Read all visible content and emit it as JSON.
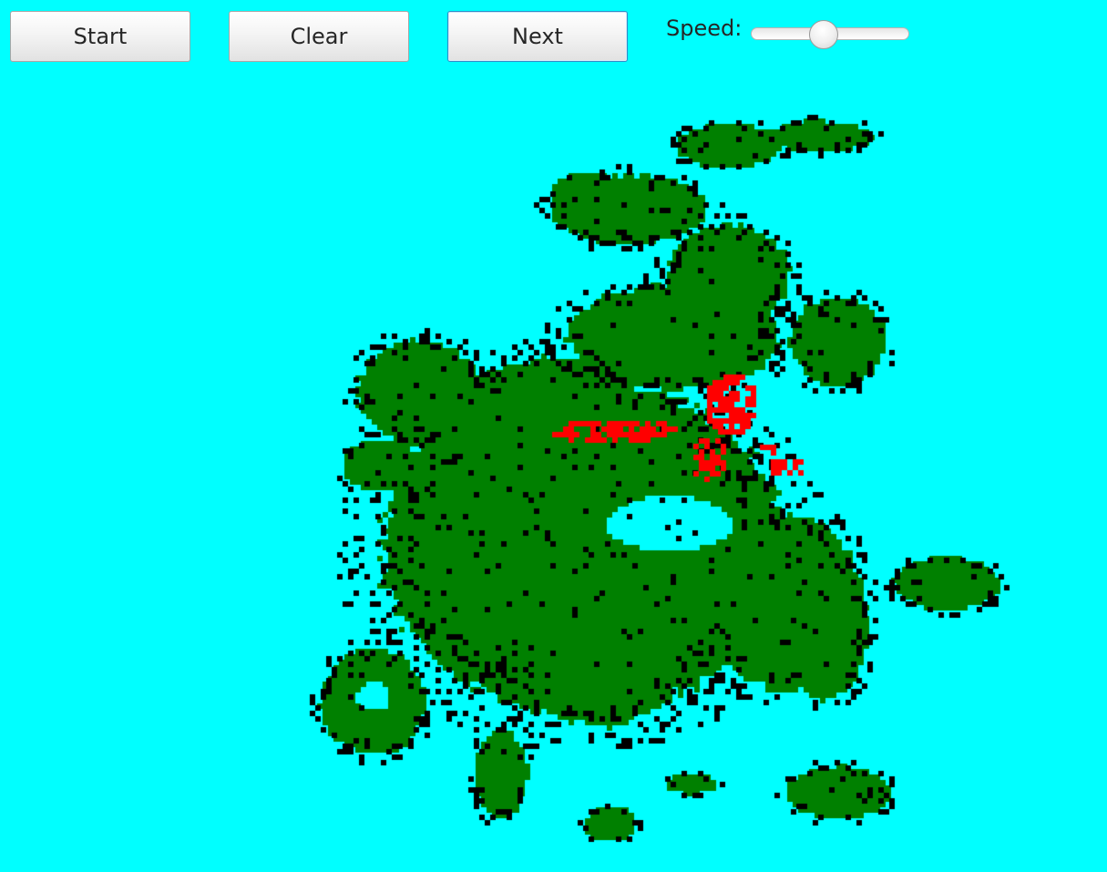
{
  "toolbar": {
    "start_label": "Start",
    "clear_label": "Clear",
    "next_label": "Next",
    "speed_label": "Speed:",
    "speed_value": 0.45
  },
  "board": {
    "colors": {
      "water": "#00FFFF",
      "land": "#008000",
      "black_cells": "#000000",
      "red_cells": "#FF0000"
    }
  }
}
